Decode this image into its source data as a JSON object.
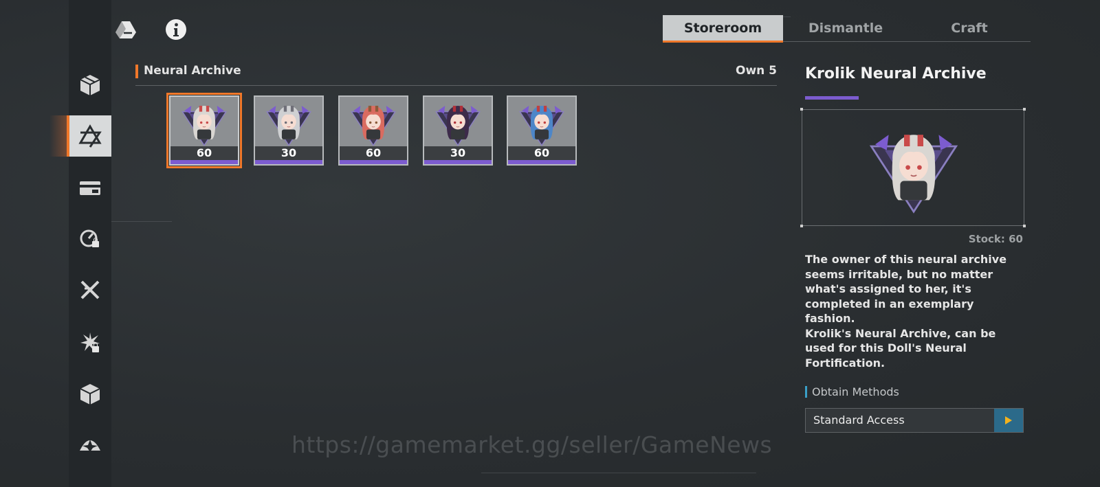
{
  "top_controls": {
    "back_icon": "chevron-left-icon",
    "drive_icon": "triangle-logo-icon",
    "info_icon": "info-icon"
  },
  "sidebar": {
    "items": [
      {
        "icon": "box-icon",
        "active": false,
        "locked": false
      },
      {
        "icon": "hexagram-icon",
        "active": true,
        "locked": false
      },
      {
        "icon": "card-icon",
        "active": false,
        "locked": false
      },
      {
        "icon": "dial-icon",
        "active": false,
        "locked": true
      },
      {
        "icon": "crossed-blades-icon",
        "active": false,
        "locked": false
      },
      {
        "icon": "burst-icon",
        "active": false,
        "locked": true
      },
      {
        "icon": "cube-icon",
        "active": false,
        "locked": false
      },
      {
        "icon": "emblem-icon",
        "active": false,
        "locked": false
      }
    ]
  },
  "tabs": [
    {
      "label": "Storeroom",
      "active": true
    },
    {
      "label": "Dismantle",
      "active": false
    },
    {
      "label": "Craft",
      "active": false
    }
  ],
  "section": {
    "title": "Neural Archive",
    "own": "Own 5"
  },
  "items": [
    {
      "count": "60",
      "selected": true,
      "hair": "#d9d6d2",
      "accent": "#c94a4a"
    },
    {
      "count": "30",
      "selected": false,
      "hair": "#cfd0d2",
      "accent": "#6f6f78"
    },
    {
      "count": "60",
      "selected": false,
      "hair": "#d96b60",
      "accent": "#8a5a3a"
    },
    {
      "count": "30",
      "selected": false,
      "hair": "#3d2b4a",
      "accent": "#b0303a"
    },
    {
      "count": "60",
      "selected": false,
      "hair": "#4d86c8",
      "accent": "#c04040"
    }
  ],
  "detail": {
    "title": "Krolik Neural Archive",
    "stock": "Stock: 60",
    "description_1": "The owner of this neural archive seems irritable, but no matter what's assigned to her, it's completed in an exemplary fashion.",
    "description_2": "Krolik's Neural Archive, can be used for this Doll's Neural Fortification.",
    "obtain_label": "Obtain Methods",
    "obtain_method": "Standard Access",
    "go_icon": "play-arrow-icon"
  },
  "watermark": "https://gamemarket.gg/seller/GameNews",
  "colors": {
    "accent_orange": "#f0782a",
    "rarity_purple": "#7c5ccf",
    "go_button_blue": "#2b6a8a"
  }
}
